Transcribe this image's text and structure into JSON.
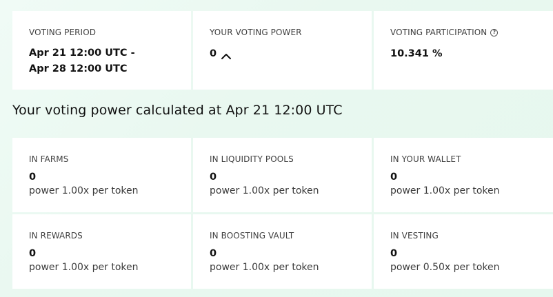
{
  "summary": {
    "voting_period": {
      "label": "VOTING PERIOD",
      "line1": "Apr 21 12:00 UTC -",
      "line2": "Apr 28 12:00 UTC"
    },
    "voting_power": {
      "label": "YOUR VOTING POWER",
      "value": "0"
    },
    "voting_participation": {
      "label": "VOTING PARTICIPATION",
      "value": "10.341 %"
    }
  },
  "section_title": "Your voting power calculated at Apr 21 12:00 UTC",
  "sources": [
    {
      "label": "IN FARMS",
      "value": "0",
      "multiplier": "power 1.00x per token"
    },
    {
      "label": "IN LIQUIDITY POOLS",
      "value": "0",
      "multiplier": "power 1.00x per token"
    },
    {
      "label": "IN YOUR WALLET",
      "value": "0",
      "multiplier": "power 1.00x per token"
    },
    {
      "label": "IN REWARDS",
      "value": "0",
      "multiplier": "power 1.00x per token"
    },
    {
      "label": "IN BOOSTING VAULT",
      "value": "0",
      "multiplier": "power 1.00x per token"
    },
    {
      "label": "IN VESTING",
      "value": "0",
      "multiplier": "power 0.50x per token"
    }
  ],
  "icons": {
    "help": "question-circle-icon",
    "chevron": "chevron-up-icon"
  }
}
